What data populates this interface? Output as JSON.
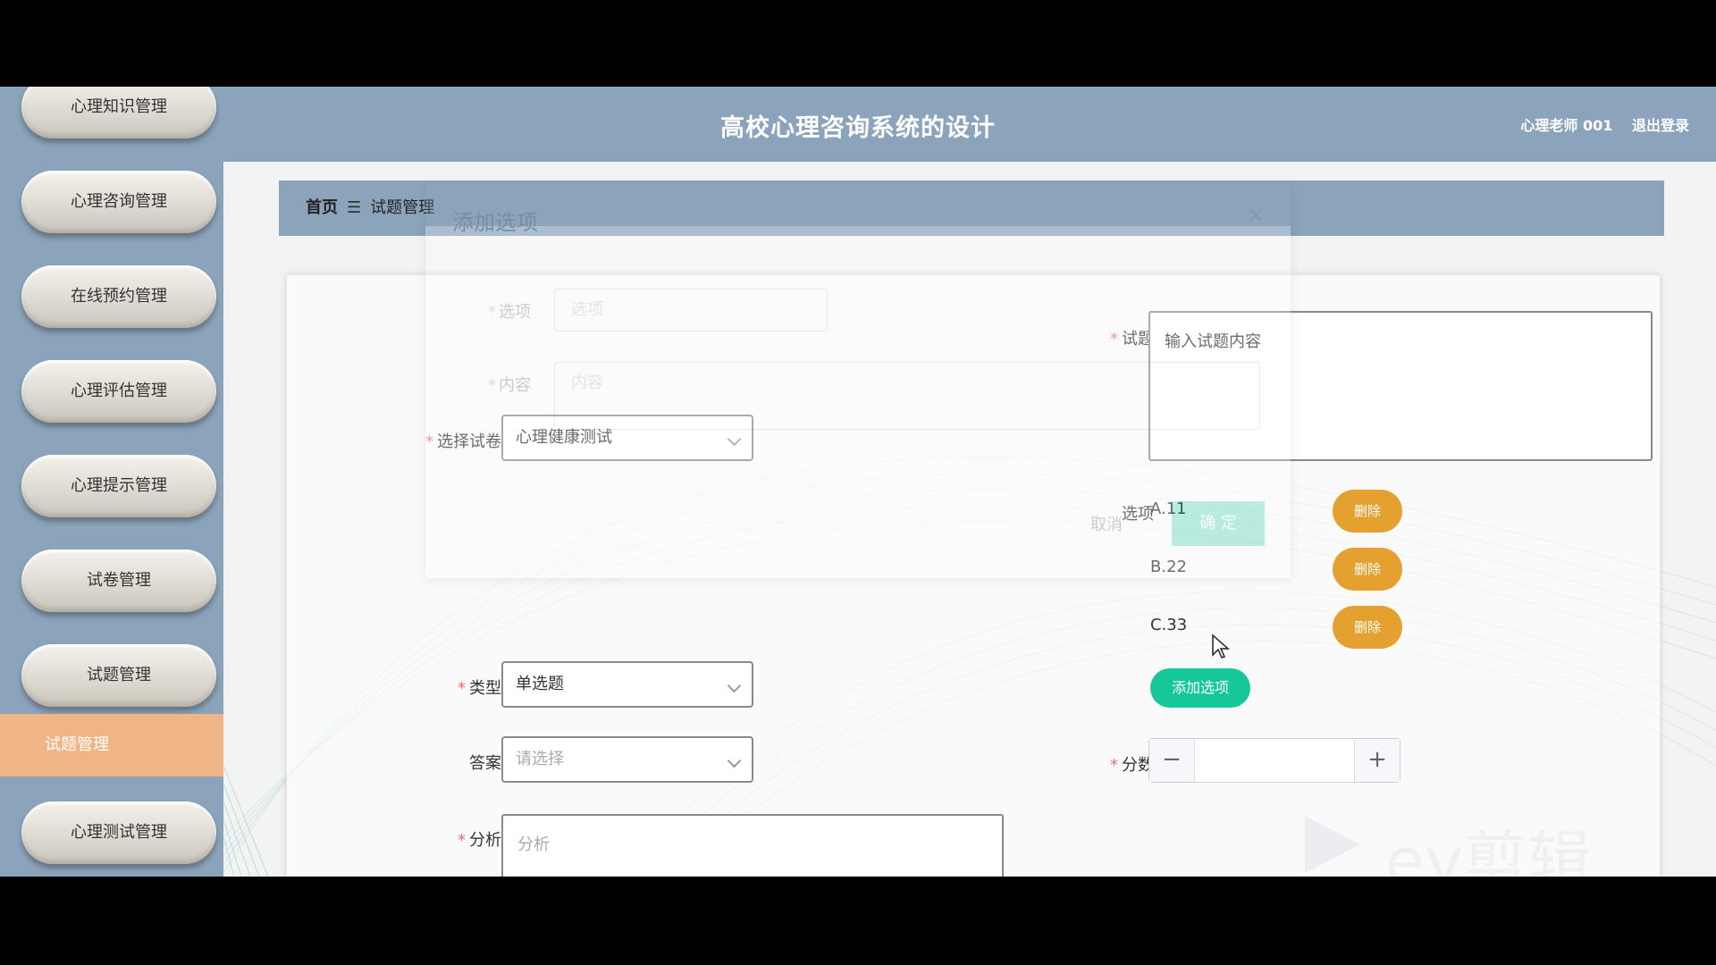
{
  "header": {
    "title": "高校心理咨询系统的设计",
    "user": "心理老师 001",
    "logout": "退出登录"
  },
  "sidebar": {
    "items": [
      {
        "label": "心理知识管理"
      },
      {
        "label": "心理咨询管理"
      },
      {
        "label": "在线预约管理"
      },
      {
        "label": "心理评估管理"
      },
      {
        "label": "心理提示管理"
      },
      {
        "label": "试卷管理"
      },
      {
        "label": "试题管理"
      },
      {
        "label": "心理测试管理"
      }
    ],
    "active_sub": "试题管理"
  },
  "breadcrumb": {
    "home": "首页",
    "sep": "☰",
    "current": "试题管理"
  },
  "form": {
    "paper_label": "选择试卷",
    "paper_value": "心理健康测试",
    "question_label": "试题",
    "question_value": "输入试题内容",
    "options_label": "选项",
    "options": [
      {
        "text": "A.11",
        "delete": "删除"
      },
      {
        "text": "B.22",
        "delete": "删除"
      },
      {
        "text": "C.33",
        "delete": "删除"
      }
    ],
    "add_option": "添加选项",
    "type_label": "类型",
    "type_value": "单选题",
    "answer_label": "答案",
    "answer_placeholder": "请选择",
    "score_label": "分数",
    "score_minus": "−",
    "score_plus": "+",
    "analysis_label": "分析",
    "analysis_placeholder": "分析"
  },
  "dialog": {
    "title": "添加选项",
    "close": "×",
    "option_label": "选项",
    "option_placeholder": "选项",
    "content_label": "内容",
    "content_placeholder": "内容",
    "cancel": "取消",
    "confirm": "确 定"
  },
  "watermark": {
    "text": "ev剪辑"
  },
  "colors": {
    "primary_blue": "#8ba4bc",
    "active_orange": "#efb585",
    "delete_orange": "#e4a12f",
    "add_green": "#16c79a",
    "required_red": "#f56c6c"
  }
}
